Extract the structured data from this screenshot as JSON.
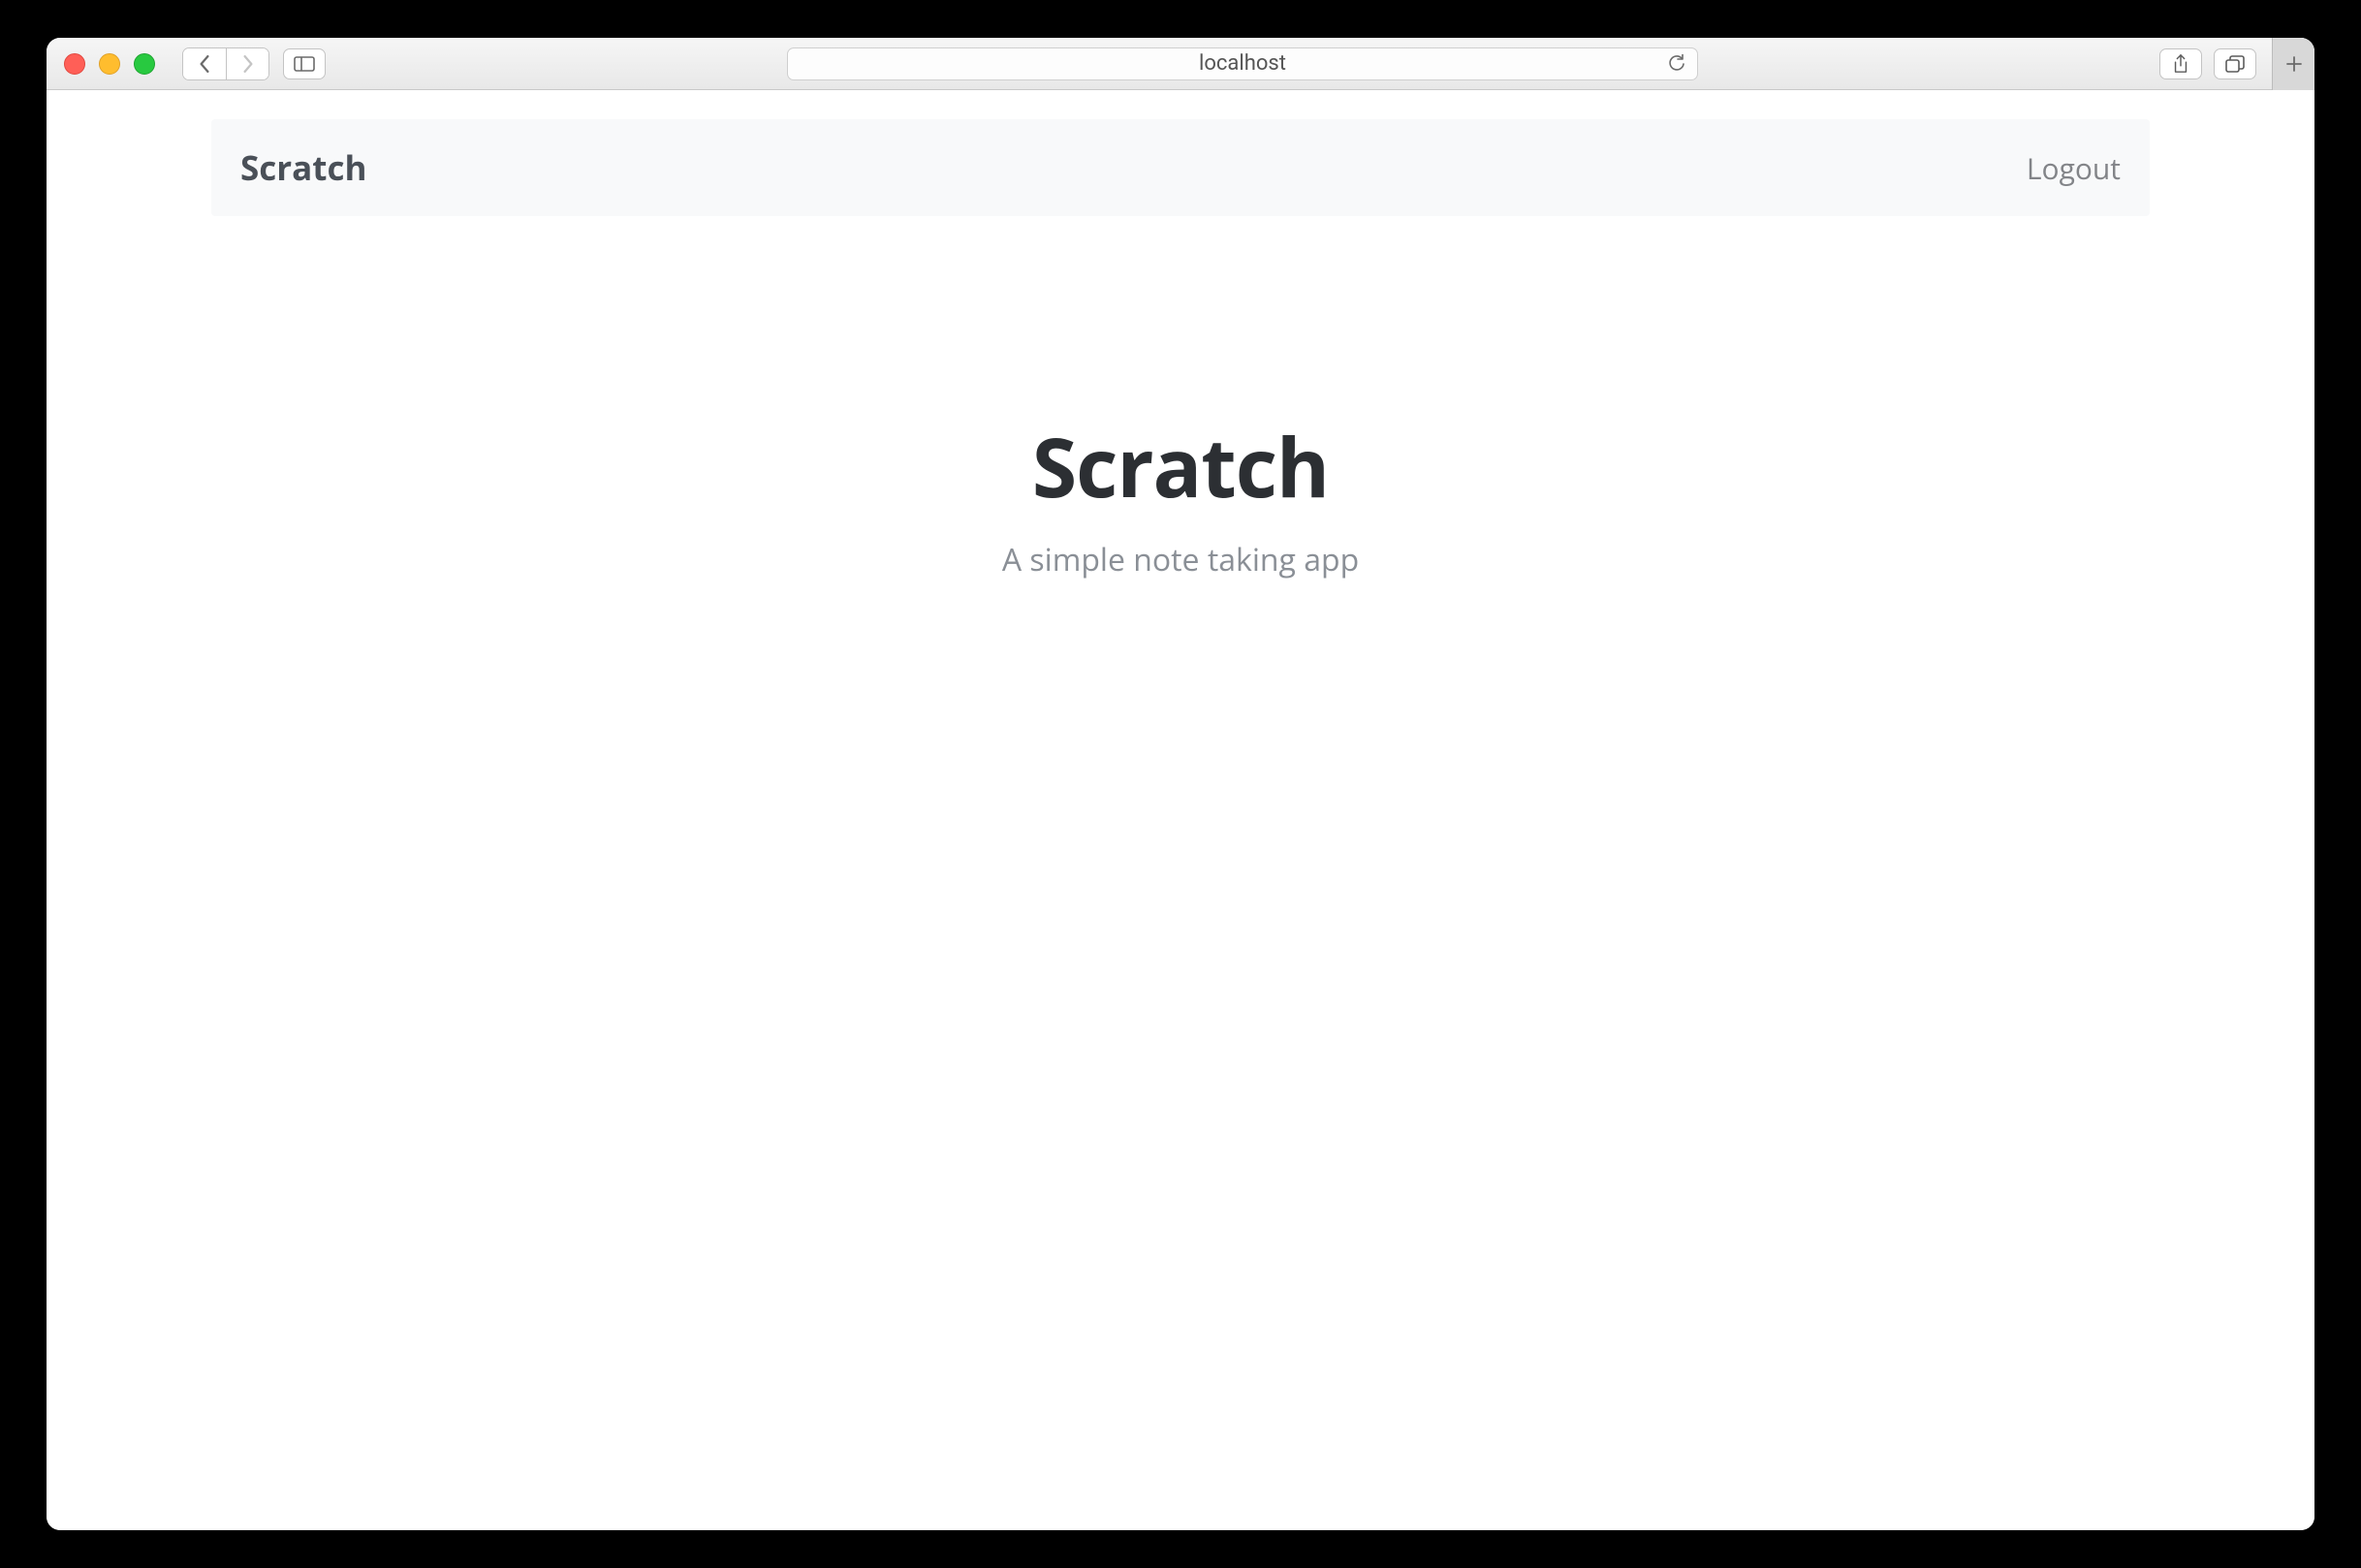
{
  "browser": {
    "address": "localhost"
  },
  "navbar": {
    "brand": "Scratch",
    "logout": "Logout"
  },
  "hero": {
    "title": "Scratch",
    "subtitle": "A simple note taking app"
  }
}
